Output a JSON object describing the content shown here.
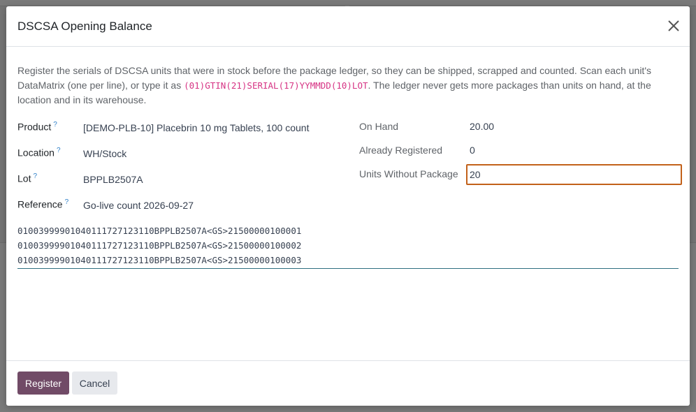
{
  "dialog": {
    "title": "DSCSA Opening Balance",
    "intro_before": "Register the serials of DSCSA units that were in stock before the package ledger, so they can be shipped, scrapped and counted. Scan each unit's DataMatrix (one per line), or type it as ",
    "intro_code": "(01)GTIN(21)SERIAL(17)YYMMDD(10)LOT",
    "intro_after": ". The ledger never gets more packages than units on hand, at the location and in its warehouse."
  },
  "fields": {
    "product_label": "Product",
    "product_value": "[DEMO-PLB-10] Placebrin 10 mg Tablets, 100 count",
    "location_label": "Location",
    "location_value": "WH/Stock",
    "lot_label": "Lot",
    "lot_value": "BPPLB2507A",
    "reference_label": "Reference",
    "reference_value": "Go-live count 2026-09-27",
    "help_marker": "?"
  },
  "stats": {
    "on_hand_label": "On Hand",
    "on_hand_value": "20.00",
    "registered_label": "Already Registered",
    "registered_value": "0",
    "units_without_label": "Units Without Package",
    "units_without_value": "20"
  },
  "serials": "01003999901040111727123110BPPLB2507A<GS>21500000100001\n01003999901040111727123110BPPLB2507A<GS>21500000100002\n01003999901040111727123110BPPLB2507A<GS>21500000100003",
  "footer": {
    "register_label": "Register",
    "cancel_label": "Cancel"
  },
  "colors": {
    "primary": "#714b67",
    "focus_border": "#c2611a",
    "help": "#2f80c8",
    "code": "#d63384"
  }
}
